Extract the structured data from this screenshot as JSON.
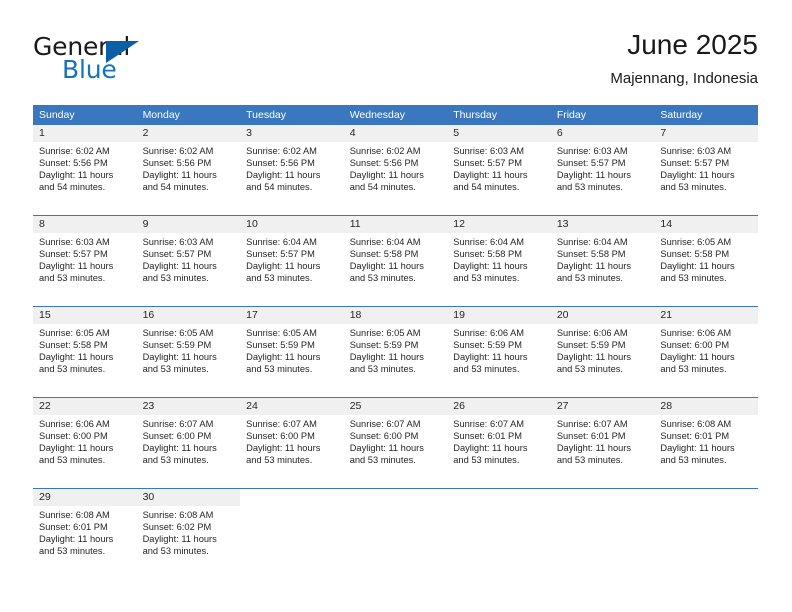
{
  "brand": {
    "name_part1": "General",
    "name_part2": "Blue",
    "flag_icon": "triangle-flag-icon"
  },
  "header": {
    "title": "June 2025",
    "subtitle": "Majennang, Indonesia"
  },
  "colors": {
    "header_blue": "#3a77be",
    "brand_blue": "#1773ba",
    "daynum_band": "#f0f0f0",
    "text": "#262626"
  },
  "weekdays": [
    "Sunday",
    "Monday",
    "Tuesday",
    "Wednesday",
    "Thursday",
    "Friday",
    "Saturday"
  ],
  "weeks": [
    [
      {
        "day": "1",
        "sunrise": "Sunrise: 6:02 AM",
        "sunset": "Sunset: 5:56 PM",
        "daylight_l1": "Daylight: 11 hours",
        "daylight_l2": "and 54 minutes."
      },
      {
        "day": "2",
        "sunrise": "Sunrise: 6:02 AM",
        "sunset": "Sunset: 5:56 PM",
        "daylight_l1": "Daylight: 11 hours",
        "daylight_l2": "and 54 minutes."
      },
      {
        "day": "3",
        "sunrise": "Sunrise: 6:02 AM",
        "sunset": "Sunset: 5:56 PM",
        "daylight_l1": "Daylight: 11 hours",
        "daylight_l2": "and 54 minutes."
      },
      {
        "day": "4",
        "sunrise": "Sunrise: 6:02 AM",
        "sunset": "Sunset: 5:56 PM",
        "daylight_l1": "Daylight: 11 hours",
        "daylight_l2": "and 54 minutes."
      },
      {
        "day": "5",
        "sunrise": "Sunrise: 6:03 AM",
        "sunset": "Sunset: 5:57 PM",
        "daylight_l1": "Daylight: 11 hours",
        "daylight_l2": "and 54 minutes."
      },
      {
        "day": "6",
        "sunrise": "Sunrise: 6:03 AM",
        "sunset": "Sunset: 5:57 PM",
        "daylight_l1": "Daylight: 11 hours",
        "daylight_l2": "and 53 minutes."
      },
      {
        "day": "7",
        "sunrise": "Sunrise: 6:03 AM",
        "sunset": "Sunset: 5:57 PM",
        "daylight_l1": "Daylight: 11 hours",
        "daylight_l2": "and 53 minutes."
      }
    ],
    [
      {
        "day": "8",
        "sunrise": "Sunrise: 6:03 AM",
        "sunset": "Sunset: 5:57 PM",
        "daylight_l1": "Daylight: 11 hours",
        "daylight_l2": "and 53 minutes."
      },
      {
        "day": "9",
        "sunrise": "Sunrise: 6:03 AM",
        "sunset": "Sunset: 5:57 PM",
        "daylight_l1": "Daylight: 11 hours",
        "daylight_l2": "and 53 minutes."
      },
      {
        "day": "10",
        "sunrise": "Sunrise: 6:04 AM",
        "sunset": "Sunset: 5:57 PM",
        "daylight_l1": "Daylight: 11 hours",
        "daylight_l2": "and 53 minutes."
      },
      {
        "day": "11",
        "sunrise": "Sunrise: 6:04 AM",
        "sunset": "Sunset: 5:58 PM",
        "daylight_l1": "Daylight: 11 hours",
        "daylight_l2": "and 53 minutes."
      },
      {
        "day": "12",
        "sunrise": "Sunrise: 6:04 AM",
        "sunset": "Sunset: 5:58 PM",
        "daylight_l1": "Daylight: 11 hours",
        "daylight_l2": "and 53 minutes."
      },
      {
        "day": "13",
        "sunrise": "Sunrise: 6:04 AM",
        "sunset": "Sunset: 5:58 PM",
        "daylight_l1": "Daylight: 11 hours",
        "daylight_l2": "and 53 minutes."
      },
      {
        "day": "14",
        "sunrise": "Sunrise: 6:05 AM",
        "sunset": "Sunset: 5:58 PM",
        "daylight_l1": "Daylight: 11 hours",
        "daylight_l2": "and 53 minutes."
      }
    ],
    [
      {
        "day": "15",
        "sunrise": "Sunrise: 6:05 AM",
        "sunset": "Sunset: 5:58 PM",
        "daylight_l1": "Daylight: 11 hours",
        "daylight_l2": "and 53 minutes."
      },
      {
        "day": "16",
        "sunrise": "Sunrise: 6:05 AM",
        "sunset": "Sunset: 5:59 PM",
        "daylight_l1": "Daylight: 11 hours",
        "daylight_l2": "and 53 minutes."
      },
      {
        "day": "17",
        "sunrise": "Sunrise: 6:05 AM",
        "sunset": "Sunset: 5:59 PM",
        "daylight_l1": "Daylight: 11 hours",
        "daylight_l2": "and 53 minutes."
      },
      {
        "day": "18",
        "sunrise": "Sunrise: 6:05 AM",
        "sunset": "Sunset: 5:59 PM",
        "daylight_l1": "Daylight: 11 hours",
        "daylight_l2": "and 53 minutes."
      },
      {
        "day": "19",
        "sunrise": "Sunrise: 6:06 AM",
        "sunset": "Sunset: 5:59 PM",
        "daylight_l1": "Daylight: 11 hours",
        "daylight_l2": "and 53 minutes."
      },
      {
        "day": "20",
        "sunrise": "Sunrise: 6:06 AM",
        "sunset": "Sunset: 5:59 PM",
        "daylight_l1": "Daylight: 11 hours",
        "daylight_l2": "and 53 minutes."
      },
      {
        "day": "21",
        "sunrise": "Sunrise: 6:06 AM",
        "sunset": "Sunset: 6:00 PM",
        "daylight_l1": "Daylight: 11 hours",
        "daylight_l2": "and 53 minutes."
      }
    ],
    [
      {
        "day": "22",
        "sunrise": "Sunrise: 6:06 AM",
        "sunset": "Sunset: 6:00 PM",
        "daylight_l1": "Daylight: 11 hours",
        "daylight_l2": "and 53 minutes."
      },
      {
        "day": "23",
        "sunrise": "Sunrise: 6:07 AM",
        "sunset": "Sunset: 6:00 PM",
        "daylight_l1": "Daylight: 11 hours",
        "daylight_l2": "and 53 minutes."
      },
      {
        "day": "24",
        "sunrise": "Sunrise: 6:07 AM",
        "sunset": "Sunset: 6:00 PM",
        "daylight_l1": "Daylight: 11 hours",
        "daylight_l2": "and 53 minutes."
      },
      {
        "day": "25",
        "sunrise": "Sunrise: 6:07 AM",
        "sunset": "Sunset: 6:00 PM",
        "daylight_l1": "Daylight: 11 hours",
        "daylight_l2": "and 53 minutes."
      },
      {
        "day": "26",
        "sunrise": "Sunrise: 6:07 AM",
        "sunset": "Sunset: 6:01 PM",
        "daylight_l1": "Daylight: 11 hours",
        "daylight_l2": "and 53 minutes."
      },
      {
        "day": "27",
        "sunrise": "Sunrise: 6:07 AM",
        "sunset": "Sunset: 6:01 PM",
        "daylight_l1": "Daylight: 11 hours",
        "daylight_l2": "and 53 minutes."
      },
      {
        "day": "28",
        "sunrise": "Sunrise: 6:08 AM",
        "sunset": "Sunset: 6:01 PM",
        "daylight_l1": "Daylight: 11 hours",
        "daylight_l2": "and 53 minutes."
      }
    ],
    [
      {
        "day": "29",
        "sunrise": "Sunrise: 6:08 AM",
        "sunset": "Sunset: 6:01 PM",
        "daylight_l1": "Daylight: 11 hours",
        "daylight_l2": "and 53 minutes."
      },
      {
        "day": "30",
        "sunrise": "Sunrise: 6:08 AM",
        "sunset": "Sunset: 6:02 PM",
        "daylight_l1": "Daylight: 11 hours",
        "daylight_l2": "and 53 minutes."
      },
      {
        "day": "",
        "sunrise": "",
        "sunset": "",
        "daylight_l1": "",
        "daylight_l2": ""
      },
      {
        "day": "",
        "sunrise": "",
        "sunset": "",
        "daylight_l1": "",
        "daylight_l2": ""
      },
      {
        "day": "",
        "sunrise": "",
        "sunset": "",
        "daylight_l1": "",
        "daylight_l2": ""
      },
      {
        "day": "",
        "sunrise": "",
        "sunset": "",
        "daylight_l1": "",
        "daylight_l2": ""
      },
      {
        "day": "",
        "sunrise": "",
        "sunset": "",
        "daylight_l1": "",
        "daylight_l2": ""
      }
    ]
  ]
}
